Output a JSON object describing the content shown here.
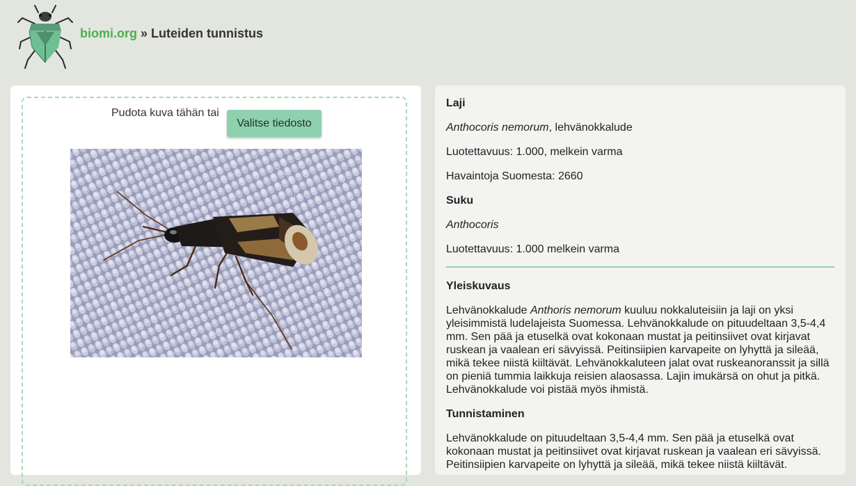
{
  "header": {
    "site_link": "biomi.org",
    "separator": "»",
    "app_name": "Luteiden tunnistus",
    "logo_icon": "shield-bug-icon"
  },
  "upload": {
    "drop_text": "Pudota kuva tähän tai",
    "button_label": "Valitse tiedosto"
  },
  "result": {
    "species_heading": "Laji",
    "species_latin": "Anthocoris nemorum",
    "species_common": ", lehvänokkalude",
    "species_confidence": "Luotettavuus: 1.000, melkein varma",
    "observations": "Havaintoja Suomesta: 2660",
    "genus_heading": "Suku",
    "genus_latin": "Anthocoris",
    "genus_confidence": "Luotettavuus: 1.000 melkein varma"
  },
  "description": {
    "overview_heading": "Yleiskuvaus",
    "overview_pre": "Lehvänokkalude ",
    "overview_latin": "Anthoris nemorum",
    "overview_text": " kuuluu nokkaluteisiin ja laji on yksi yleisimmistä ludelajeista Suomessa. Lehvänokkalude on pituudeltaan 3,5-4,4 mm. Sen pää ja etuselkä ovat kokonaan mustat ja peitinsiivet ovat kirjavat ruskean ja vaalean eri sävyissä. Peitinsiipien karvapeite on lyhyttä ja sileää, mikä tekee niistä kiiltävät. Lehvänokkaluteen jalat ovat ruskeanoranssit ja sillä on pieniä tummia laikkuja reisien alaosassa. Lajin imukärsä on ohut ja pitkä. Lehvänokkalude voi pistää myös ihmistä.",
    "identification_heading": "Tunnistaminen",
    "identification_text": "Lehvänokkalude on pituudeltaan 3,5-4,4 mm. Sen pää ja etuselkä ovat kokonaan mustat ja peitinsiivet ovat kirjavat ruskean ja vaalean eri sävyissä. Peitinsiipien karvapeite on lyhyttä ja sileää, mikä tekee niistä kiiltävät."
  },
  "colors": {
    "brand_green": "#4caf50",
    "button_green": "#8fd0af",
    "background": "#e3e5df"
  }
}
